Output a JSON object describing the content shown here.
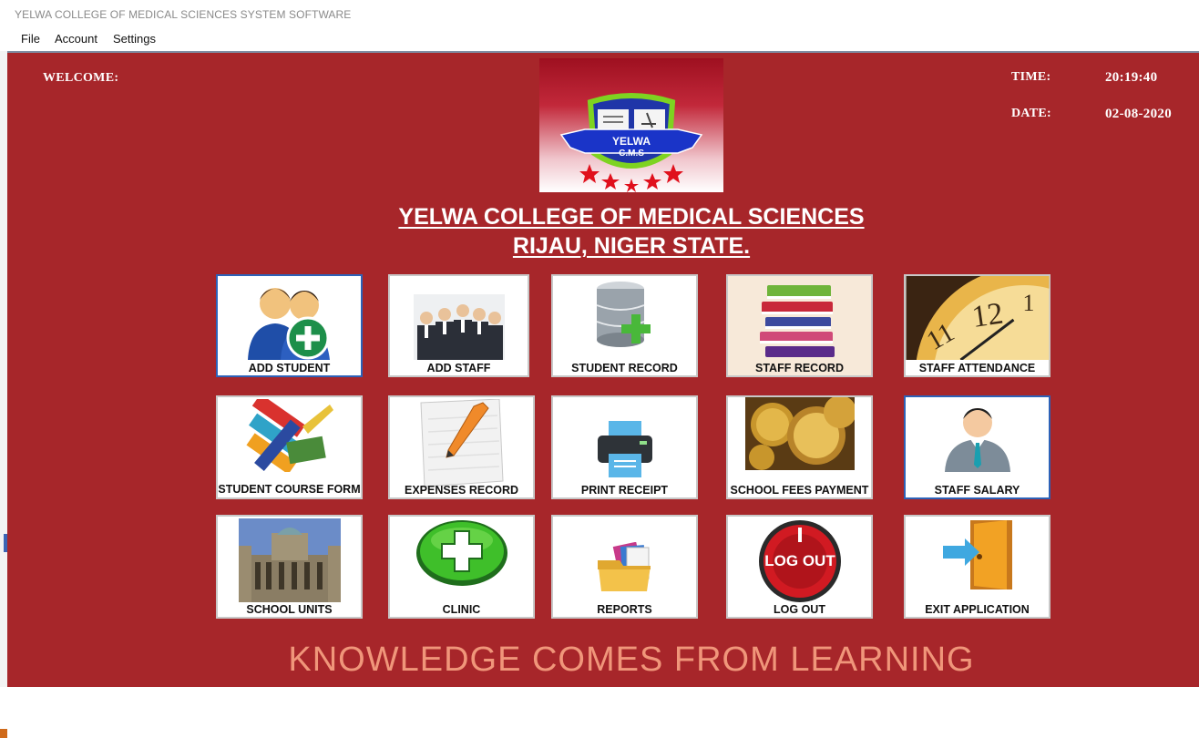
{
  "window": {
    "title": "YELWA  COLLEGE OF MEDICAL SCIENCES SYSTEM SOFTWARE"
  },
  "menu": {
    "file": "File",
    "account": "Account",
    "settings": "Settings"
  },
  "header": {
    "welcome_label": "WELCOME:",
    "time_label": "TIME:",
    "time_value": "20:19:40",
    "date_label": "DATE:",
    "date_value": "02-08-2020"
  },
  "logo": {
    "line1": "YELWA",
    "line2": "C.M.S"
  },
  "college": {
    "line1": "YELWA COLLEGE OF MEDICAL SCIENCES",
    "line2": "RIJAU, NIGER STATE."
  },
  "tiles": [
    {
      "label": "ADD STUDENT"
    },
    {
      "label": "ADD STAFF"
    },
    {
      "label": "STUDENT RECORD"
    },
    {
      "label": "STAFF RECORD"
    },
    {
      "label": "STAFF ATTENDANCE"
    },
    {
      "label": "STUDENT COURSE FORM"
    },
    {
      "label": "EXPENSES RECORD"
    },
    {
      "label": "PRINT RECEIPT"
    },
    {
      "label": "SCHOOL FEES PAYMENT"
    },
    {
      "label": "STAFF SALARY"
    },
    {
      "label": "SCHOOL UNITS"
    },
    {
      "label": "CLINIC"
    },
    {
      "label": "REPORTS"
    },
    {
      "label": "LOG OUT",
      "icon_text": "LOG OUT"
    },
    {
      "label": "EXIT APPLICATION"
    }
  ],
  "motto": "KNOWLEDGE COMES FROM LEARNING",
  "colors": {
    "background": "#a7262a",
    "motto": "#f0967a",
    "selected_border": "#2d62b8"
  }
}
